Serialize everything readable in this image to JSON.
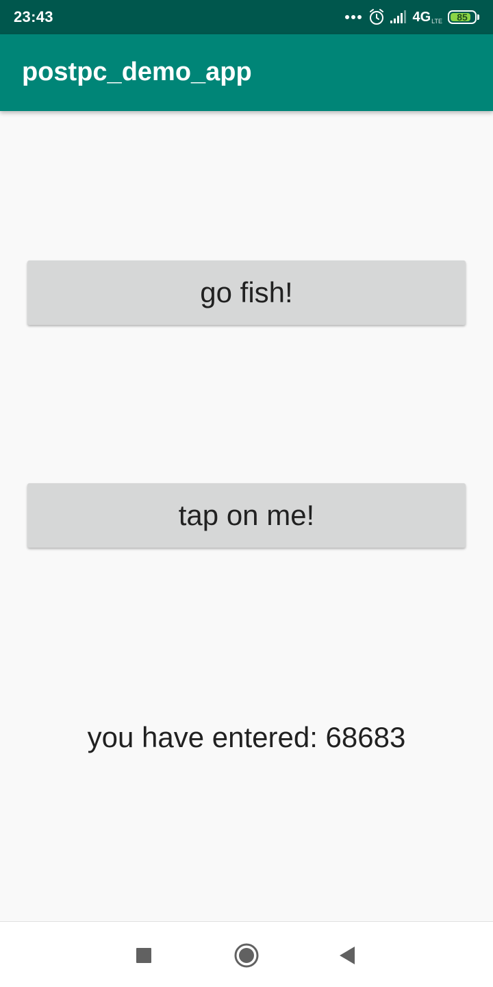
{
  "status_bar": {
    "time": "23:43",
    "network_type": "4G",
    "network_sub": "LTE",
    "battery_level": "85",
    "battery_fraction": 0.85,
    "icons": [
      "more-dots-icon",
      "alarm-icon",
      "signal-icon",
      "battery-icon"
    ],
    "background_color": "#00574d"
  },
  "app_bar": {
    "title": "postpc_demo_app",
    "background_color": "#008577"
  },
  "main": {
    "go_fish_button_label": "go fish!",
    "tap_button_label": "tap on me!",
    "result_text": "you have entered: 68683",
    "button_color": "#d6d7d7",
    "background_color": "#f9f9f9"
  },
  "nav_bar": {
    "icons": [
      "recent-apps-icon",
      "home-icon",
      "back-icon"
    ]
  }
}
